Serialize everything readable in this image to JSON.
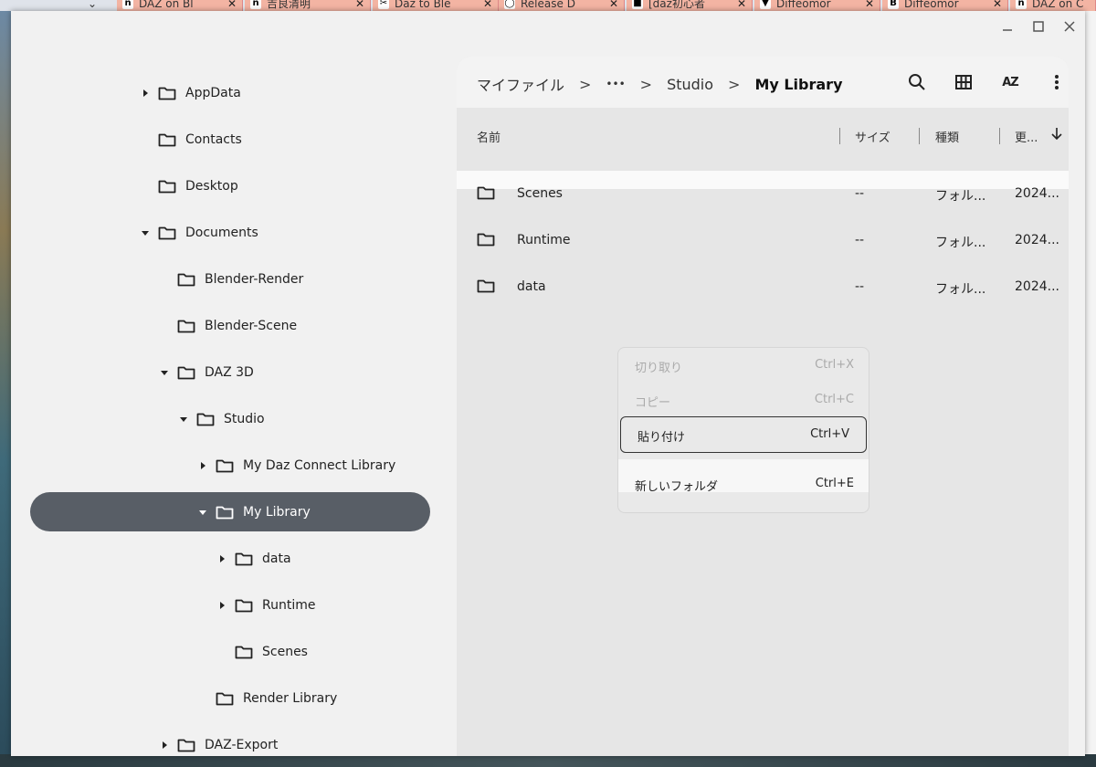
{
  "browser_tabs": [
    {
      "favicon": "n",
      "title": "DAZ on Bl"
    },
    {
      "favicon": "n",
      "title": "吉良清明"
    },
    {
      "favicon": "✂",
      "title": "Daz to Ble"
    },
    {
      "favicon": "◯",
      "title": "Release D"
    },
    {
      "favicon": "■",
      "title": "[daz初心者"
    },
    {
      "favicon": "▼",
      "title": "Diffeomor"
    },
    {
      "favicon": "B",
      "title": "Diffeomor"
    },
    {
      "favicon": "n",
      "title": "DAZ on C"
    }
  ],
  "window": {
    "controls": [
      "minimize",
      "maximize",
      "close"
    ]
  },
  "tree": [
    {
      "label": "AppData",
      "caret": "right",
      "depth": 0
    },
    {
      "label": "Contacts",
      "caret": "none",
      "depth": 0
    },
    {
      "label": "Desktop",
      "caret": "none",
      "depth": 0
    },
    {
      "label": "Documents",
      "caret": "down",
      "depth": 0
    },
    {
      "label": "Blender-Render",
      "caret": "none",
      "depth": 1
    },
    {
      "label": "Blender-Scene",
      "caret": "none",
      "depth": 1
    },
    {
      "label": "DAZ 3D",
      "caret": "down",
      "depth": 1
    },
    {
      "label": "Studio",
      "caret": "down",
      "depth": 2
    },
    {
      "label": "My Daz Connect Library",
      "caret": "right",
      "depth": 3
    },
    {
      "label": "My Library",
      "caret": "down",
      "depth": 3,
      "selected": true
    },
    {
      "label": "data",
      "caret": "right",
      "depth": 4
    },
    {
      "label": "Runtime",
      "caret": "right",
      "depth": 4
    },
    {
      "label": "Scenes",
      "caret": "none",
      "depth": 4
    },
    {
      "label": "Render Library",
      "caret": "none",
      "depth": 3
    },
    {
      "label": "DAZ-Export",
      "caret": "right",
      "depth": 1
    }
  ],
  "breadcrumb": {
    "root": "マイファイル",
    "ellipsis": "•••",
    "parent": "Studio",
    "current": "My Library",
    "separator": ">"
  },
  "toolbar": {
    "sort_label": "AZ"
  },
  "columns": {
    "name": "名前",
    "size": "サイズ",
    "kind": "種類",
    "modified": "更..."
  },
  "files": [
    {
      "name": "Scenes",
      "size": "--",
      "kind": "フォル...",
      "modified": "2024..."
    },
    {
      "name": "Runtime",
      "size": "--",
      "kind": "フォル...",
      "modified": "2024..."
    },
    {
      "name": "data",
      "size": "--",
      "kind": "フォル...",
      "modified": "2024..."
    }
  ],
  "context_menu": [
    {
      "label": "切り取り",
      "shortcut": "Ctrl+X",
      "state": "disabled"
    },
    {
      "label": "コピー",
      "shortcut": "Ctrl+C",
      "state": "disabled"
    },
    {
      "label": "貼り付け",
      "shortcut": "Ctrl+V",
      "state": "focused"
    },
    {
      "label": "新しいフォルダ",
      "shortcut": "Ctrl+E",
      "state": "enabled"
    }
  ]
}
